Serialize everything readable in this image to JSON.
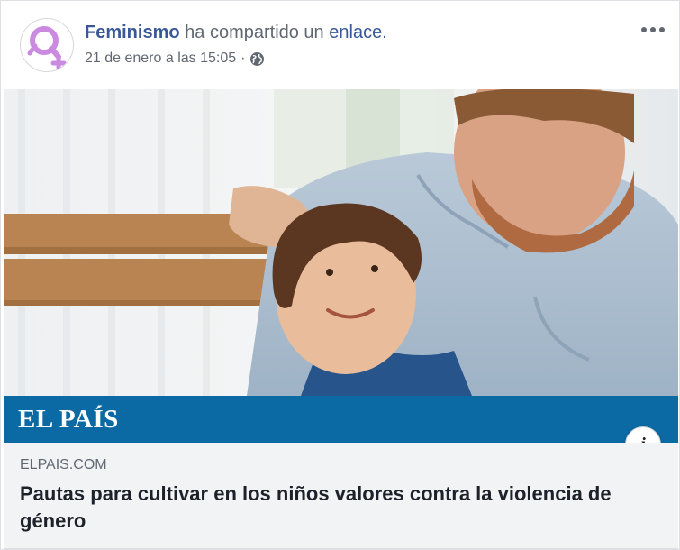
{
  "post": {
    "author": "Feminismo",
    "action_prefix": "ha compartido un",
    "action_link": "enlace.",
    "date": "21 de enero a las 15:05",
    "separator": "·",
    "privacy_icon": "globe-icon",
    "more_icon": "more-dots-icon"
  },
  "link_preview": {
    "source_logo": "EL PAÍS",
    "domain": "ELPAIS.COM",
    "title": "Pautas para cultivar en los niños valores contra la violencia de género",
    "info_icon_label": "i"
  },
  "colors": {
    "author_link": "#385898",
    "banner": "#0b6aa3",
    "preview_bg": "#f2f3f5",
    "avatar_symbol": "#c98ae0"
  }
}
